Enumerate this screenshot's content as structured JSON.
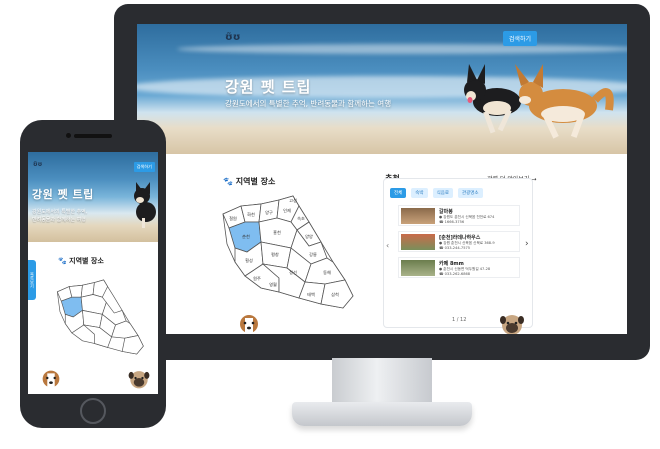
{
  "desktop": {
    "logo": "ʊ̃ʊ",
    "cta_label": "검색하기",
    "hero_title": "강원 펫 트립",
    "hero_subtitle": "강원도에서의 특별한 추억, 반려동물과 함께하는 여행",
    "region_title": "지역별 장소",
    "reco_title": "추천",
    "reco_more": "관련 더 알아보기 →",
    "chips": [
      "전체",
      "숙박",
      "식음료",
      "관광명소"
    ],
    "places": [
      {
        "name": "갈마봉",
        "address": "강원도 춘천시 신북읍 천전로 674",
        "phone": "1666-3756"
      },
      {
        "name": "[춘천]라데나하우스",
        "address": "강원 춘천시 신북읍 신북로 368-9",
        "phone": "033-244-7575"
      },
      {
        "name": "카페 8mm",
        "address": "춘천시 신동면 덕두원길 47-28",
        "phone": "033-262-6868"
      }
    ],
    "pager": "1 / 12",
    "map_regions": [
      "철원",
      "화천",
      "양구",
      "인제",
      "고성",
      "속초",
      "양양",
      "춘천",
      "홍천",
      "강릉",
      "횡성",
      "평창",
      "원주",
      "영월",
      "정선",
      "동해",
      "삼척",
      "태백"
    ]
  },
  "mobile": {
    "logo": "ʊ̃ʊ",
    "cta_label": "검색하기",
    "hero_title": "강원 펫 트립",
    "hero_subtitle_1": "강원도에서의 특별한 추억,",
    "hero_subtitle_2": "반려동물과 함께하는 여행",
    "side_tab": "목록보기",
    "region_title": "지역별 장소"
  },
  "colors": {
    "accent": "#2c9be6",
    "highlight_region": "#7fbdf0",
    "device_frame": "#2a2c30"
  }
}
